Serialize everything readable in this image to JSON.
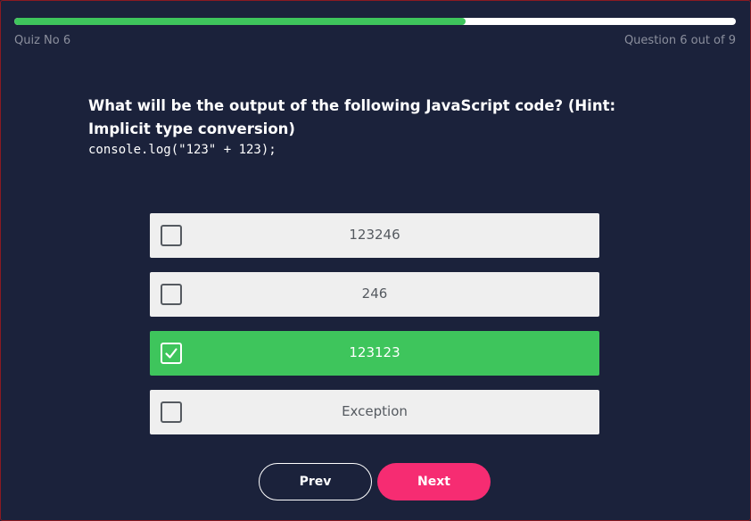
{
  "progress": {
    "fraction": 0.625
  },
  "header": {
    "quiz_label": "Quiz No 6",
    "question_count": "Question 6 out of 9"
  },
  "question": {
    "text": "What will be the output of the following JavaScript code? (Hint: Implicit type conversion)",
    "code": "console.log(\"123\" + 123);"
  },
  "options": [
    {
      "label": "123246",
      "checked": false
    },
    {
      "label": "246",
      "checked": false
    },
    {
      "label": "123123",
      "checked": true
    },
    {
      "label": "Exception",
      "checked": false
    }
  ],
  "buttons": {
    "prev_label": "Prev",
    "next_label": "Next"
  },
  "colors": {
    "background": "#1b223b",
    "accent_green": "#3ec55c",
    "next_button": "#f62c72",
    "option_bg": "#efefef"
  }
}
